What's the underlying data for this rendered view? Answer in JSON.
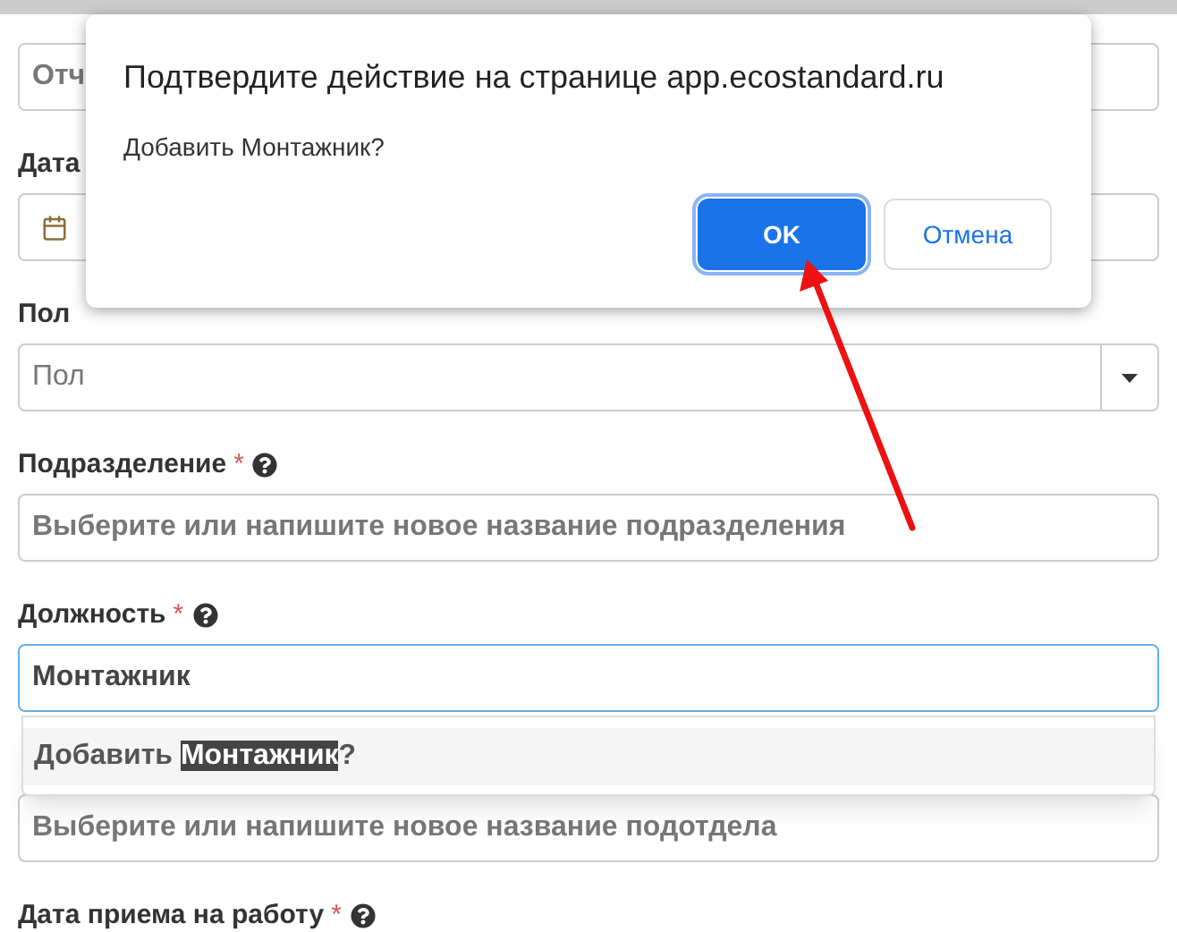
{
  "dialog": {
    "title": "Подтвердите действие на странице app.ecostandard.ru",
    "message": "Добавить Монтажник?",
    "buttons": [
      {
        "label": "OK",
        "kind": "primary",
        "focused": true
      },
      {
        "label": "Отмена",
        "kind": "secondary",
        "focused": false
      }
    ]
  },
  "form": {
    "fields": [
      {
        "kind": "text",
        "placeholder": "Отч"
      },
      {
        "kind": "date",
        "label": "Дата"
      },
      {
        "kind": "select",
        "label": "Пол",
        "placeholder": "Пол"
      },
      {
        "kind": "text",
        "label": "Подразделение",
        "required_mark": "*",
        "help": true,
        "placeholder": "Выберите или напишите новое название подразделения"
      },
      {
        "kind": "text",
        "label": "Должность",
        "required_mark": "*",
        "help": true,
        "value": "Монтажник",
        "focused": true,
        "suggestion": "Добавить **Монтажник**?"
      },
      {
        "kind": "text",
        "placeholder": "Выберите или напишите новое название подотдела"
      },
      {
        "kind": "label",
        "label": "Дата приема на работу",
        "required_mark": "*",
        "help": true
      }
    ]
  }
}
